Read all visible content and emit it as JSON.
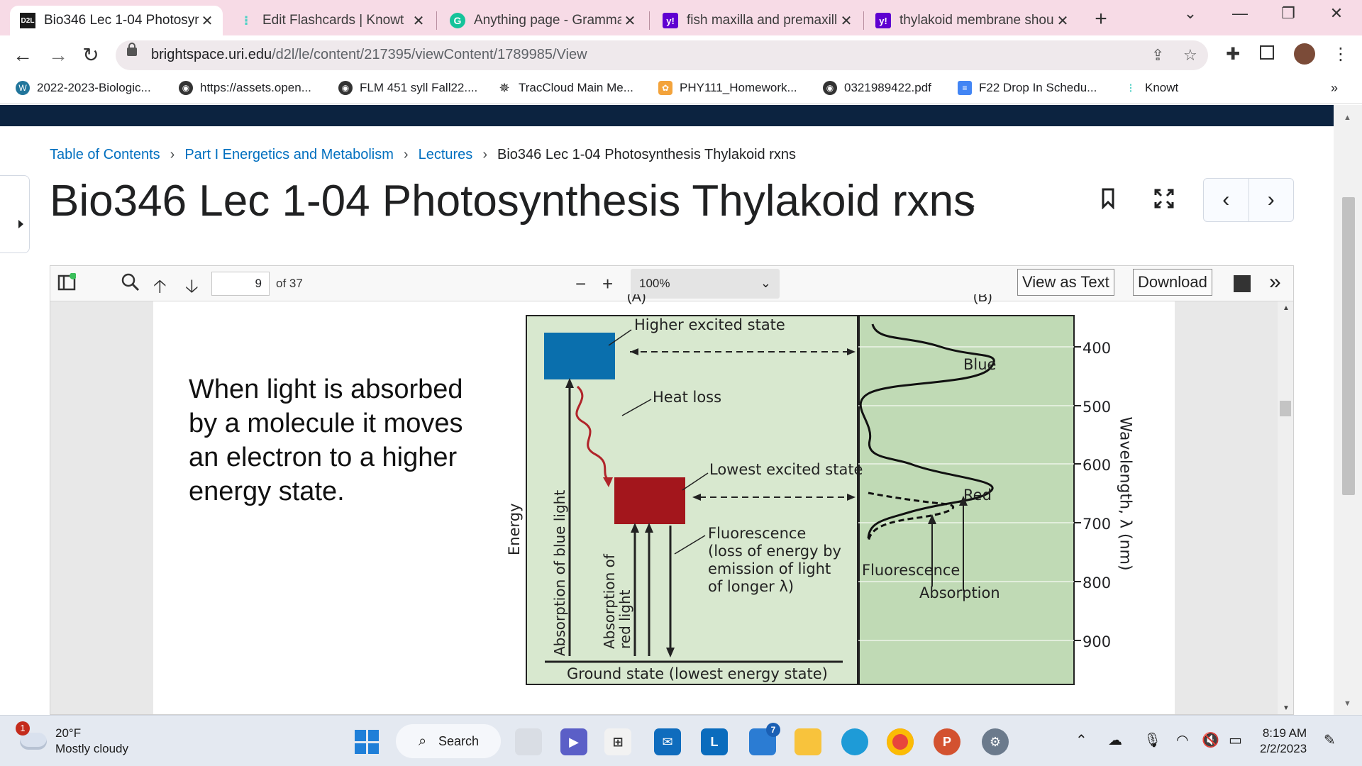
{
  "tabs": [
    {
      "title": "Bio346 Lec 1-04 Photosyn",
      "icon": "d2l-icon",
      "active": true
    },
    {
      "title": "Edit Flashcards | Knowt",
      "icon": "knowt-icon",
      "active": false
    },
    {
      "title": "Anything page - Gramma",
      "icon": "grammarly-icon",
      "active": false
    },
    {
      "title": "fish maxilla and premaxill",
      "icon": "yahoo-icon",
      "active": false
    },
    {
      "title": "thylakoid membrane shou",
      "icon": "yahoo-icon",
      "active": false
    }
  ],
  "address": {
    "domain": "brightspace.uri.edu",
    "path": "/d2l/le/content/217395/viewContent/1789985/View"
  },
  "bookmarks": [
    {
      "label": "2022-2023-Biologic...",
      "icon": "wordpress-icon"
    },
    {
      "label": "https://assets.open...",
      "icon": "globe-icon"
    },
    {
      "label": "FLM 451 syll Fall22....",
      "icon": "globe-icon"
    },
    {
      "label": "TracCloud Main Me...",
      "icon": "traccloud-icon"
    },
    {
      "label": "PHY111_Homework...",
      "icon": "homework-icon"
    },
    {
      "label": "0321989422.pdf",
      "icon": "globe-icon"
    },
    {
      "label": "F22 Drop In Schedu...",
      "icon": "docs-icon"
    },
    {
      "label": "Knowt",
      "icon": "knowt-icon"
    }
  ],
  "breadcrumb": {
    "items": [
      "Table of Contents",
      "Part I Energetics and Metabolism",
      "Lectures"
    ],
    "current": "Bio346 Lec 1-04 Photosynthesis Thylakoid rxns"
  },
  "page_title": "Bio346 Lec 1-04 Photosynthesis Thylakoid rxns",
  "viewer": {
    "page_number": "9",
    "page_total": "of 37",
    "zoom": "100%",
    "view_as_text": "View as Text",
    "download": "Download"
  },
  "slide": {
    "text": "When light is absorbed by a molecule it moves an electron to a higher energy state.",
    "figure": {
      "panel_a": "(A)",
      "panel_b": "(B)",
      "energy_label": "Energy",
      "higher_excited": "Higher excited state",
      "heat_loss": "Heat loss",
      "lowest_excited": "Lowest excited state",
      "fluorescence_line1": "Fluorescence",
      "fluorescence_line2": "(loss of energy by",
      "fluorescence_line3": "emission of light",
      "fluorescence_line4": "of longer λ)",
      "blue_absorption": "Absorption of blue light",
      "red_absorption_line1": "Absorption of",
      "red_absorption_line2": "red light",
      "ground_state": "Ground state (lowest energy state)",
      "blue": "Blue",
      "red": "Red",
      "fluorescence": "Fluorescence",
      "absorption": "Absorption",
      "wavelength_label": "Wavelength, λ (nm)",
      "ticks": [
        "400",
        "500",
        "600",
        "700",
        "800",
        "900"
      ],
      "colors": {
        "panel_bg": "#d8e8cf",
        "blue_box": "#0a6fad",
        "red_box": "#a3161c",
        "heat_arrow": "#b0242a"
      }
    }
  },
  "taskbar": {
    "temperature": "20°F",
    "weather": "Mostly cloudy",
    "badge": "1",
    "search": "Search",
    "mail_badge": "7",
    "time": "8:19 AM",
    "date": "2/2/2023"
  }
}
